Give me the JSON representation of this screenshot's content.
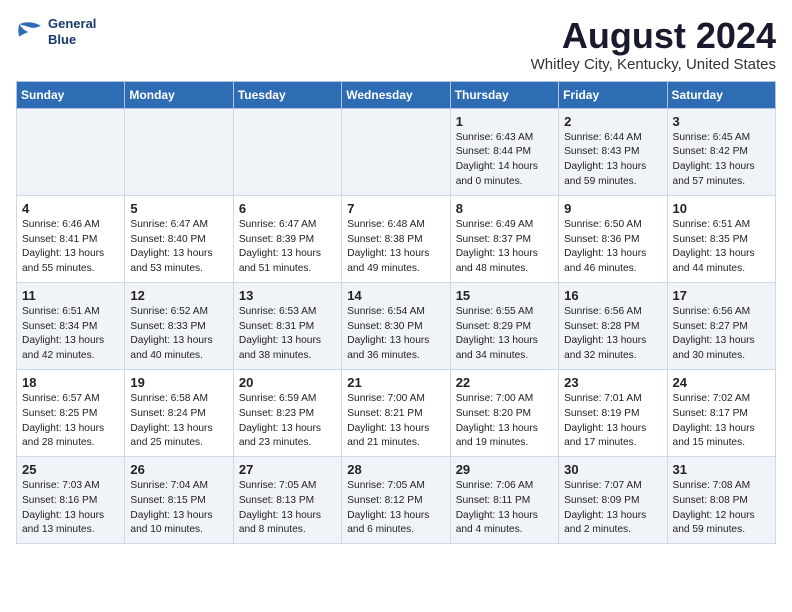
{
  "logo": {
    "line1": "General",
    "line2": "Blue"
  },
  "title": "August 2024",
  "subtitle": "Whitley City, Kentucky, United States",
  "days_of_week": [
    "Sunday",
    "Monday",
    "Tuesday",
    "Wednesday",
    "Thursday",
    "Friday",
    "Saturday"
  ],
  "weeks": [
    [
      {
        "day": "",
        "info": ""
      },
      {
        "day": "",
        "info": ""
      },
      {
        "day": "",
        "info": ""
      },
      {
        "day": "",
        "info": ""
      },
      {
        "day": "1",
        "info": "Sunrise: 6:43 AM\nSunset: 8:44 PM\nDaylight: 14 hours\nand 0 minutes."
      },
      {
        "day": "2",
        "info": "Sunrise: 6:44 AM\nSunset: 8:43 PM\nDaylight: 13 hours\nand 59 minutes."
      },
      {
        "day": "3",
        "info": "Sunrise: 6:45 AM\nSunset: 8:42 PM\nDaylight: 13 hours\nand 57 minutes."
      }
    ],
    [
      {
        "day": "4",
        "info": "Sunrise: 6:46 AM\nSunset: 8:41 PM\nDaylight: 13 hours\nand 55 minutes."
      },
      {
        "day": "5",
        "info": "Sunrise: 6:47 AM\nSunset: 8:40 PM\nDaylight: 13 hours\nand 53 minutes."
      },
      {
        "day": "6",
        "info": "Sunrise: 6:47 AM\nSunset: 8:39 PM\nDaylight: 13 hours\nand 51 minutes."
      },
      {
        "day": "7",
        "info": "Sunrise: 6:48 AM\nSunset: 8:38 PM\nDaylight: 13 hours\nand 49 minutes."
      },
      {
        "day": "8",
        "info": "Sunrise: 6:49 AM\nSunset: 8:37 PM\nDaylight: 13 hours\nand 48 minutes."
      },
      {
        "day": "9",
        "info": "Sunrise: 6:50 AM\nSunset: 8:36 PM\nDaylight: 13 hours\nand 46 minutes."
      },
      {
        "day": "10",
        "info": "Sunrise: 6:51 AM\nSunset: 8:35 PM\nDaylight: 13 hours\nand 44 minutes."
      }
    ],
    [
      {
        "day": "11",
        "info": "Sunrise: 6:51 AM\nSunset: 8:34 PM\nDaylight: 13 hours\nand 42 minutes."
      },
      {
        "day": "12",
        "info": "Sunrise: 6:52 AM\nSunset: 8:33 PM\nDaylight: 13 hours\nand 40 minutes."
      },
      {
        "day": "13",
        "info": "Sunrise: 6:53 AM\nSunset: 8:31 PM\nDaylight: 13 hours\nand 38 minutes."
      },
      {
        "day": "14",
        "info": "Sunrise: 6:54 AM\nSunset: 8:30 PM\nDaylight: 13 hours\nand 36 minutes."
      },
      {
        "day": "15",
        "info": "Sunrise: 6:55 AM\nSunset: 8:29 PM\nDaylight: 13 hours\nand 34 minutes."
      },
      {
        "day": "16",
        "info": "Sunrise: 6:56 AM\nSunset: 8:28 PM\nDaylight: 13 hours\nand 32 minutes."
      },
      {
        "day": "17",
        "info": "Sunrise: 6:56 AM\nSunset: 8:27 PM\nDaylight: 13 hours\nand 30 minutes."
      }
    ],
    [
      {
        "day": "18",
        "info": "Sunrise: 6:57 AM\nSunset: 8:25 PM\nDaylight: 13 hours\nand 28 minutes."
      },
      {
        "day": "19",
        "info": "Sunrise: 6:58 AM\nSunset: 8:24 PM\nDaylight: 13 hours\nand 25 minutes."
      },
      {
        "day": "20",
        "info": "Sunrise: 6:59 AM\nSunset: 8:23 PM\nDaylight: 13 hours\nand 23 minutes."
      },
      {
        "day": "21",
        "info": "Sunrise: 7:00 AM\nSunset: 8:21 PM\nDaylight: 13 hours\nand 21 minutes."
      },
      {
        "day": "22",
        "info": "Sunrise: 7:00 AM\nSunset: 8:20 PM\nDaylight: 13 hours\nand 19 minutes."
      },
      {
        "day": "23",
        "info": "Sunrise: 7:01 AM\nSunset: 8:19 PM\nDaylight: 13 hours\nand 17 minutes."
      },
      {
        "day": "24",
        "info": "Sunrise: 7:02 AM\nSunset: 8:17 PM\nDaylight: 13 hours\nand 15 minutes."
      }
    ],
    [
      {
        "day": "25",
        "info": "Sunrise: 7:03 AM\nSunset: 8:16 PM\nDaylight: 13 hours\nand 13 minutes."
      },
      {
        "day": "26",
        "info": "Sunrise: 7:04 AM\nSunset: 8:15 PM\nDaylight: 13 hours\nand 10 minutes."
      },
      {
        "day": "27",
        "info": "Sunrise: 7:05 AM\nSunset: 8:13 PM\nDaylight: 13 hours\nand 8 minutes."
      },
      {
        "day": "28",
        "info": "Sunrise: 7:05 AM\nSunset: 8:12 PM\nDaylight: 13 hours\nand 6 minutes."
      },
      {
        "day": "29",
        "info": "Sunrise: 7:06 AM\nSunset: 8:11 PM\nDaylight: 13 hours\nand 4 minutes."
      },
      {
        "day": "30",
        "info": "Sunrise: 7:07 AM\nSunset: 8:09 PM\nDaylight: 13 hours\nand 2 minutes."
      },
      {
        "day": "31",
        "info": "Sunrise: 7:08 AM\nSunset: 8:08 PM\nDaylight: 12 hours\nand 59 minutes."
      }
    ]
  ]
}
